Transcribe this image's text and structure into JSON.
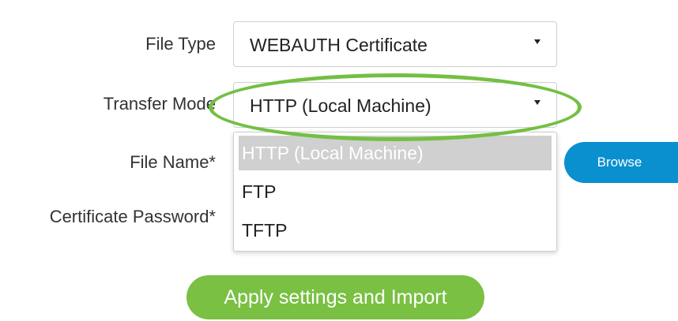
{
  "form": {
    "file_type_label": "File Type",
    "file_type_value": "WEBAUTH Certificate",
    "transfer_mode_label": "Transfer Mode",
    "transfer_mode_value": "HTTP (Local Machine)",
    "transfer_mode_options": [
      "HTTP (Local Machine)",
      "FTP",
      "TFTP"
    ],
    "file_name_label": "File Name*",
    "certificate_password_label": "Certificate Password*",
    "browse_label": "Browse",
    "apply_label": "Apply settings and Import"
  },
  "colors": {
    "highlight_ring": "#73bf43",
    "browse_button": "#0a8fcf",
    "apply_button": "#79c043",
    "selected_option_bg": "#d0d0d0"
  }
}
